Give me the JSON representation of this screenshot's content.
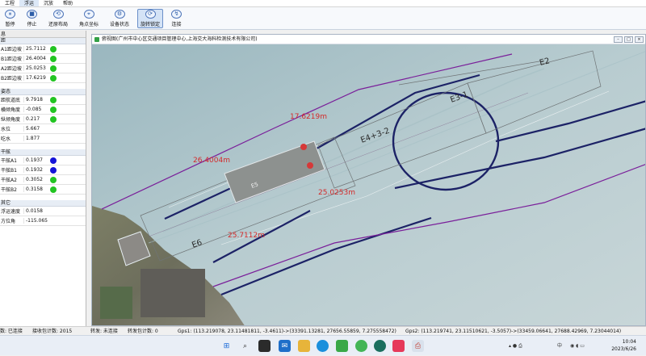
{
  "menu": [
    "工程",
    "浮运",
    "沉放",
    "帮助"
  ],
  "toolbar": [
    {
      "label": "暂停",
      "icon": "pause-icon",
      "glyph": "⏸",
      "active": false
    },
    {
      "label": "停止",
      "icon": "stop-icon",
      "glyph": "■",
      "active": false
    },
    {
      "label": "还原布局",
      "icon": "layout-icon",
      "glyph": "⟲",
      "active": false
    },
    {
      "label": "角点坐标",
      "icon": "corner-icon",
      "glyph": "⌖",
      "active": false
    },
    {
      "label": "设备状态",
      "icon": "device-icon",
      "glyph": "⚙",
      "active": false
    },
    {
      "label": "旋转锁定",
      "icon": "lock-icon",
      "glyph": "⟳",
      "active": true
    },
    {
      "label": "连接",
      "icon": "link-icon",
      "glyph": "↯",
      "active": false
    }
  ],
  "left_panel": {
    "title": "息",
    "groups": [
      {
        "title": "距",
        "rows": [
          {
            "label": "A1距边坡",
            "value": "25.7112",
            "dot": "#22c422"
          },
          {
            "label": "B1距边坡",
            "value": "26.4004",
            "dot": "#22c422"
          },
          {
            "label": "A2距边坡",
            "value": "25.0253",
            "dot": "#22c422"
          },
          {
            "label": "B2距边坡",
            "value": "17.6219",
            "dot": "#22c422"
          }
        ]
      },
      {
        "title": "姿态",
        "rows": [
          {
            "label": "距航道底",
            "value": "9.7918",
            "dot": "#22c422"
          },
          {
            "label": "横倾角度",
            "value": "-0.085",
            "dot": "#22c422"
          },
          {
            "label": "纵倾角度",
            "value": "0.217",
            "dot": "#22c422"
          },
          {
            "label": "水位",
            "value": "5.667",
            "dot": ""
          },
          {
            "label": "吃水",
            "value": "1.877",
            "dot": ""
          }
        ]
      },
      {
        "title": "干舷",
        "rows": [
          {
            "label": "干舷A1",
            "value": "0.1937",
            "dot": "#1414d8"
          },
          {
            "label": "干舷B1",
            "value": "0.1932",
            "dot": "#1414d8"
          },
          {
            "label": "干舷A2",
            "value": "0.3052",
            "dot": "#22c422"
          },
          {
            "label": "干舷B2",
            "value": "0.3158",
            "dot": "#22c422"
          }
        ]
      },
      {
        "title": "其它",
        "rows": [
          {
            "label": "浮运速度",
            "value": "0.0158",
            "dot": ""
          },
          {
            "label": "方位角",
            "value": "-115.065",
            "dot": ""
          }
        ]
      }
    ]
  },
  "window": {
    "title": "俯视图(广州市中心区交通项目管理中心,上海交大海科检测技术有限公司)"
  },
  "map": {
    "distances": {
      "a1": "25.7112m",
      "b1": "26.4004m",
      "a2": "25.0253m",
      "b2": "17.6219m"
    },
    "segments": {
      "e2": "E2",
      "e3": "E3-1",
      "e4": "E4+3-2",
      "e6": "E6"
    },
    "element_label": "E5"
  },
  "status": {
    "connection": "数: 已连接",
    "recv": "接收包计数: 2015",
    "forward": "转发: 未连接",
    "forward_count": "转发包计数: 0",
    "gps1": "Gps1: (113.219078, 23.11481811, -3.4611)->(33391.13281, 27656.55859, 7.275558472)",
    "gps2": "Gps2: (113.219741, 23.11510621, -3.5057)->(33459.06641, 27688.42969, 7.23044014)"
  },
  "taskbar": {
    "time": "10:04",
    "date": "2023/6/26",
    "lang": "中"
  }
}
